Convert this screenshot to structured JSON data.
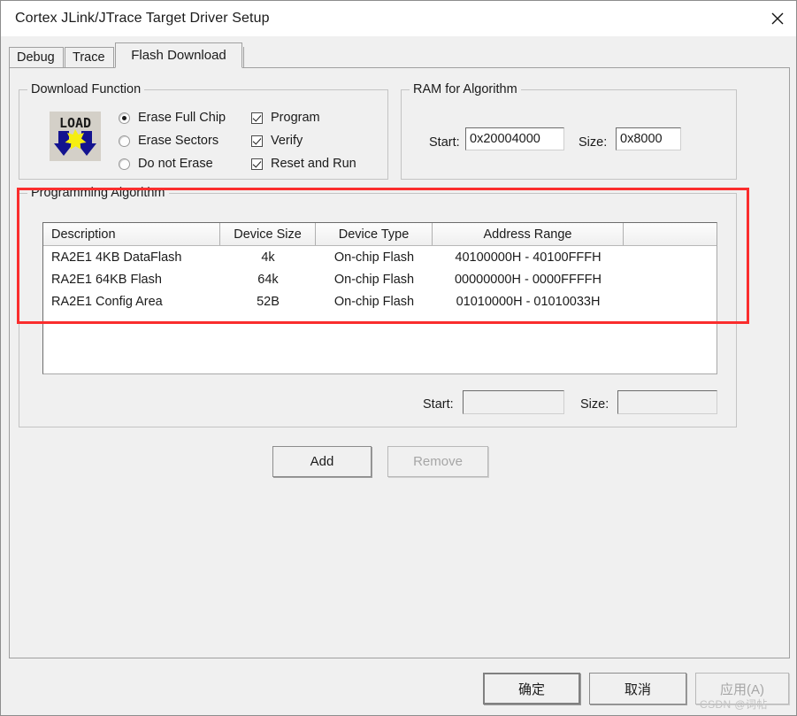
{
  "window": {
    "title": "Cortex JLink/JTrace Target Driver Setup",
    "close_icon": "close-icon"
  },
  "tabs": [
    {
      "label": "Debug",
      "selected": false
    },
    {
      "label": "Trace",
      "selected": false
    },
    {
      "label": "Flash Download",
      "selected": true
    }
  ],
  "download_function": {
    "title": "Download Function",
    "icon": "load-icon",
    "erase_options": [
      {
        "label": "Erase Full Chip",
        "checked": true
      },
      {
        "label": "Erase Sectors",
        "checked": false
      },
      {
        "label": "Do not Erase",
        "checked": false
      }
    ],
    "checkboxes": [
      {
        "label": "Program",
        "checked": true
      },
      {
        "label": "Verify",
        "checked": true
      },
      {
        "label": "Reset and Run",
        "checked": true
      }
    ]
  },
  "ram_for_algorithm": {
    "title": "RAM for Algorithm",
    "start_label": "Start:",
    "start_value": "0x20004000",
    "size_label": "Size:",
    "size_value": "0x8000"
  },
  "programming_algorithm": {
    "title": "Programming Algorithm",
    "columns": [
      "Description",
      "Device Size",
      "Device Type",
      "Address Range",
      ""
    ],
    "rows": [
      {
        "description": "RA2E1 4KB DataFlash",
        "device_size": "4k",
        "device_type": "On-chip Flash",
        "address_range": "40100000H - 40100FFFH",
        "extra": ""
      },
      {
        "description": "RA2E1 64KB Flash",
        "device_size": "64k",
        "device_type": "On-chip Flash",
        "address_range": "00000000H - 0000FFFFH",
        "extra": ""
      },
      {
        "description": "RA2E1 Config Area",
        "device_size": "52B",
        "device_type": "On-chip Flash",
        "address_range": "01010000H - 01010033H",
        "extra": ""
      }
    ],
    "start_label": "Start:",
    "start_value": "",
    "size_label": "Size:",
    "size_value": ""
  },
  "list_buttons": {
    "add": "Add",
    "remove": "Remove"
  },
  "dialog_buttons": {
    "ok": "确定",
    "cancel": "取消",
    "apply": "应用(A)"
  },
  "watermark": "CSDN @词帖",
  "colors": {
    "highlight": "#fa2d2d",
    "dialog_face": "#f0f0f0",
    "text": "#1b1b1b"
  }
}
